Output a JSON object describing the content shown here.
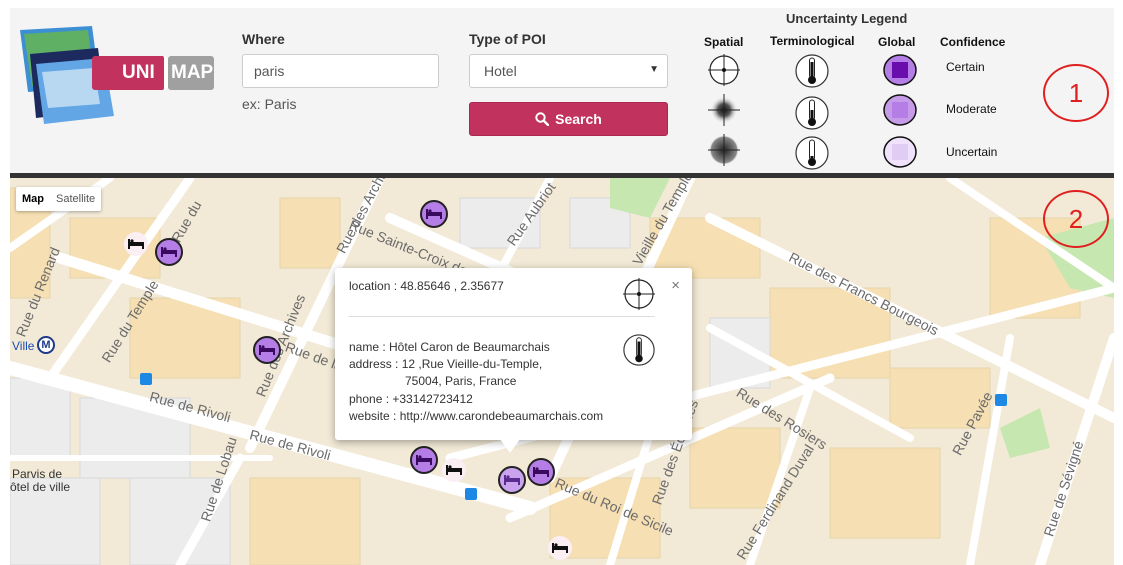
{
  "header": {
    "logo_text_left": "UNI",
    "logo_text_right": "MAP",
    "where": {
      "label": "Where",
      "value": "paris",
      "example": "ex: Paris"
    },
    "poi": {
      "label": "Type of POI",
      "selected": "Hotel"
    },
    "search_button": "Search",
    "legend": {
      "title": "Uncertainty Legend",
      "columns": [
        "Spatial",
        "Terminological",
        "Global",
        "Confidence"
      ],
      "levels": [
        "Certain",
        "Moderate",
        "Uncertain"
      ],
      "colors": {
        "certain": "#6a0dad",
        "moderate": "#b57ee6",
        "uncertain": "#e7d4f7"
      }
    }
  },
  "annotations": {
    "header_number": "1",
    "map_number": "2"
  },
  "map": {
    "map_type_active": "Map",
    "map_type_other": "Satellite",
    "streets": [
      "Rue Sainte-Croix de la",
      "Rue des Archives",
      "Rue Aubriot",
      "Vieille du Temple",
      "Rue des Francs Bourgeois",
      "Rue du Renard",
      "Rue du Temple",
      "Rue des Archives",
      "Rue de Rivoli",
      "Rue de Rivoli",
      "Rue de Lobau",
      "Rue des Rosiers",
      "Rue des Écouffes",
      "Rue du Roi de Sicile",
      "Rue Pavée",
      "Rue de Sévigné",
      "Rue Ferdinand Duval",
      "Rue de la",
      "Rue du"
    ],
    "places": {
      "metro": "Ville",
      "metro_symbol": "M",
      "parvis": "Parvis de",
      "parvis2": "ôtel de ville"
    },
    "popup": {
      "location": "location : 48.85646 , 2.35677",
      "name": "name : Hôtel Caron de Beaumarchais",
      "address1": "address : 12 ,Rue Vieille-du-Temple,",
      "address2": "75004, Paris, France",
      "phone": "phone : +33142723412",
      "website": "website : http://www.carondebeaumarchais.com",
      "close": "×"
    }
  }
}
